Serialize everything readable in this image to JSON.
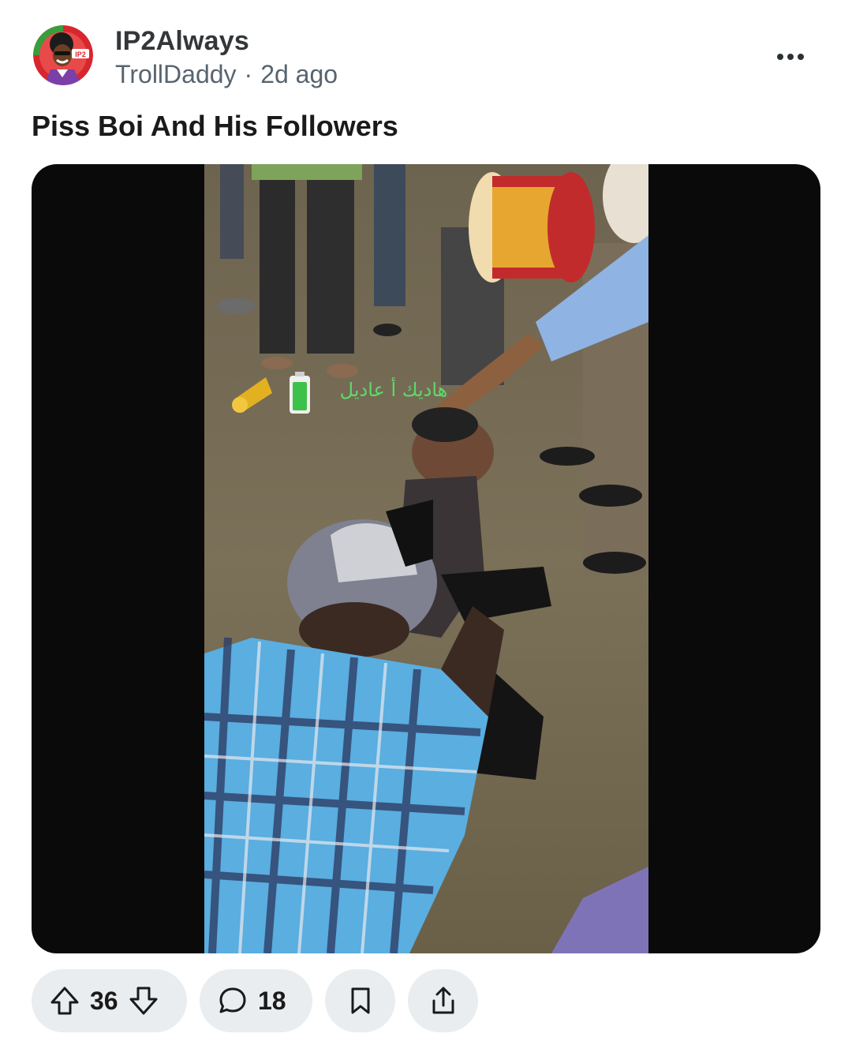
{
  "post": {
    "community": "IP2Always",
    "author": "TrollDaddy",
    "separator": "·",
    "time": "2d ago",
    "title": "Piss Boi And His Followers",
    "avatar_badge": "IP2",
    "video_overlay_text": "هاديك أ عاديل",
    "video_overlay_emojis": [
      "trumpet-icon",
      "battery-icon"
    ]
  },
  "actions": {
    "upvotes": "36",
    "comments": "18"
  },
  "icons": {
    "more": "more-horizontal-icon",
    "upvote": "arrow-up-icon",
    "downvote": "arrow-down-icon",
    "comment": "speech-bubble-icon",
    "save": "bookmark-icon",
    "share": "share-icon"
  },
  "colors": {
    "pill_bg": "#eaedef",
    "text_primary": "#1a1a1b",
    "text_secondary": "#576470",
    "media_bg": "#0a0a0a"
  }
}
